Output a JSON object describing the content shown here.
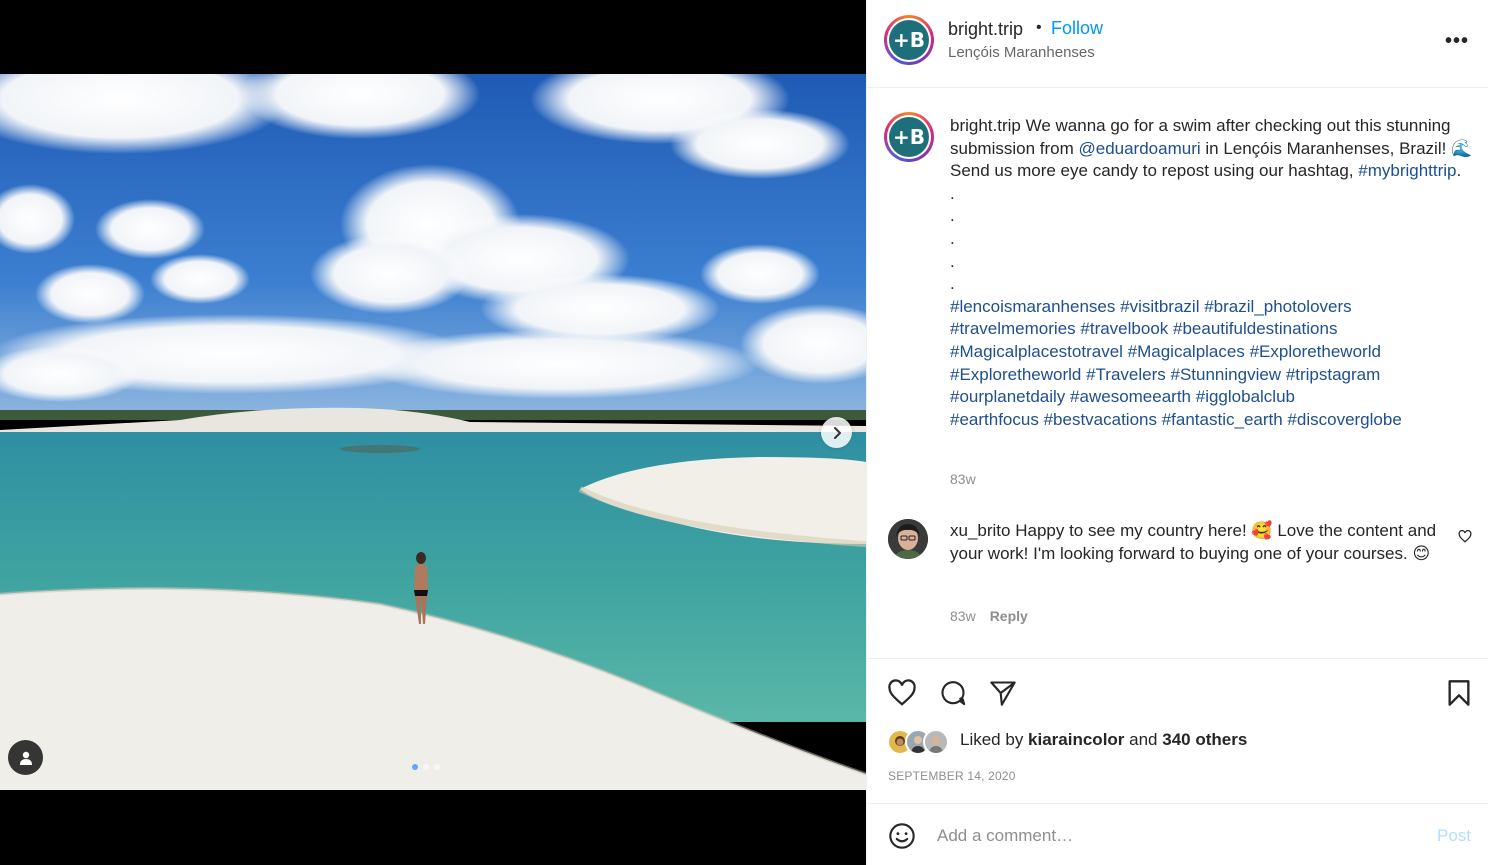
{
  "post": {
    "author": "bright.trip",
    "author_initial": "+B",
    "separator": "•",
    "follow_label": "Follow",
    "location": "Lençóis Maranhenses",
    "more_label": "•••"
  },
  "caption": {
    "username": "bright.trip",
    "text_1": " We wanna go for a swim after checking out this stunning submission from ",
    "mention": "@eduardoamuri",
    "text_2": " in Lençóis Maranhenses, Brazil! 🌊 Send us more eye candy to repost using our hashtag, ",
    "hashtag_main": "#mybrighttrip",
    "text_3": ".",
    "dots": [
      ".",
      ".",
      ".",
      ".",
      "."
    ],
    "hashtags": [
      [
        "#lencoismaranhenses",
        "#visitbrazil",
        "#brazil_photolovers"
      ],
      [
        "#travelmemories",
        "#travelbook",
        "#beautifuldestinations"
      ],
      [
        "#Magicalplacestotravel",
        "#Magicalplaces",
        "#Exploretheworld"
      ],
      [
        "#Exploretheworld",
        "#Travelers",
        "#Stunningview",
        "#tripstagram"
      ],
      [
        "#ourplanetdaily",
        "#awesomeearth",
        "#igglobalclub"
      ],
      [
        "#earthfocus",
        "#bestvacations",
        "#fantastic_earth",
        "#discoverglobe"
      ]
    ],
    "age": "83w"
  },
  "comment": {
    "username": "xu_brito",
    "text": " Happy to see my country here! 🥰 Love the content and your work! I'm looking forward to buying one of your courses. 😊",
    "age": "83w",
    "reply_label": "Reply"
  },
  "likes": {
    "prefix": "Liked by ",
    "liker": "kiaraincolor",
    "middle": " and ",
    "others": "340 others"
  },
  "date": "SEPTEMBER 14, 2020",
  "comment_box": {
    "placeholder": "Add a comment…",
    "post_label": "Post"
  },
  "carousel": {
    "slides": 3,
    "active_index": 0
  },
  "colors": {
    "link": "#1e4f8f",
    "follow": "#0095f6",
    "post_disabled": "#b2dffc",
    "muted": "#8e8e8e"
  }
}
